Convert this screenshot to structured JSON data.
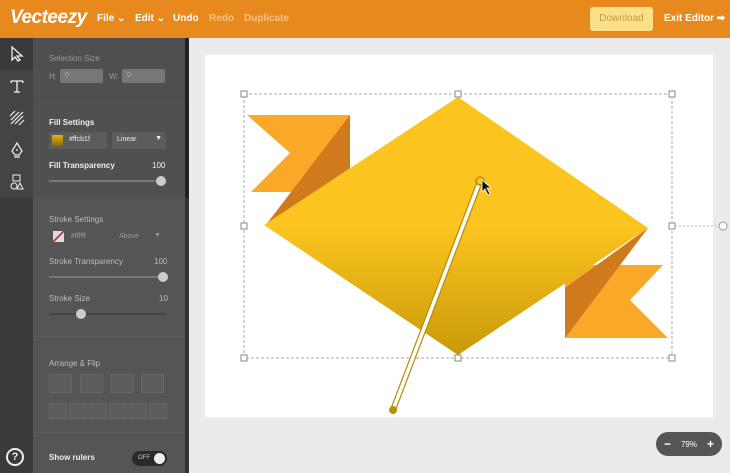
{
  "header": {
    "logo": "Vecteezy",
    "menu": {
      "file": "File",
      "edit": "Edit",
      "undo": "Undo",
      "redo": "Redo",
      "duplicate": "Duplicate"
    },
    "download": "Download",
    "exit": "Exit Editor"
  },
  "panel": {
    "selection": {
      "title": "Selection Size",
      "h_label": "H:",
      "h_value": "0",
      "w_label": "W:",
      "w_value": "0"
    },
    "fill": {
      "title": "Fill Settings",
      "color": "#ffcb1f",
      "type": "Linear",
      "transparency_label": "Fill Transparency",
      "transparency": "100"
    },
    "stroke": {
      "title": "Stroke Settings",
      "color": "#ffffff",
      "position": "Above",
      "transparency_label": "Stroke Transparency",
      "transparency": "100",
      "size_label": "Stroke Size",
      "size": "10"
    },
    "arrange": {
      "title": "Arrange & Flip"
    },
    "rulers": {
      "label": "Show rulers",
      "state": "OFF"
    }
  },
  "zoom": {
    "minus": "−",
    "value": "79%",
    "plus": "+"
  },
  "colors": {
    "accent": "#e8891d",
    "fill": "#fcc41f"
  }
}
